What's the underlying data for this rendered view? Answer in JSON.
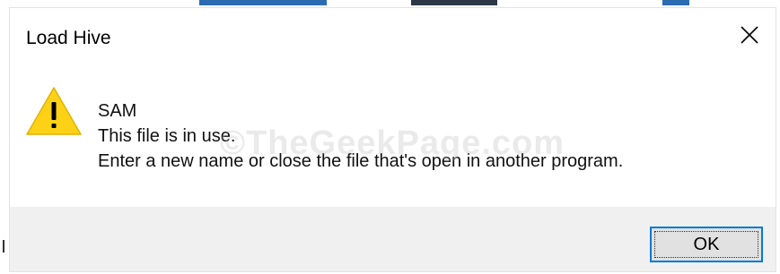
{
  "dialog": {
    "title": "Load Hive",
    "close_icon": "close-icon",
    "warning_icon": "warning-triangle-icon",
    "file_name": "SAM",
    "status_message": "This file is in use.",
    "instruction_message": "Enter a new name or close the file that's open in another program.",
    "ok_label": "OK"
  },
  "watermark": "©TheGeekPage.com",
  "colors": {
    "accent": "#0078d7",
    "warning_fill": "#fcd116",
    "footer_bg": "#f0f0f0"
  }
}
